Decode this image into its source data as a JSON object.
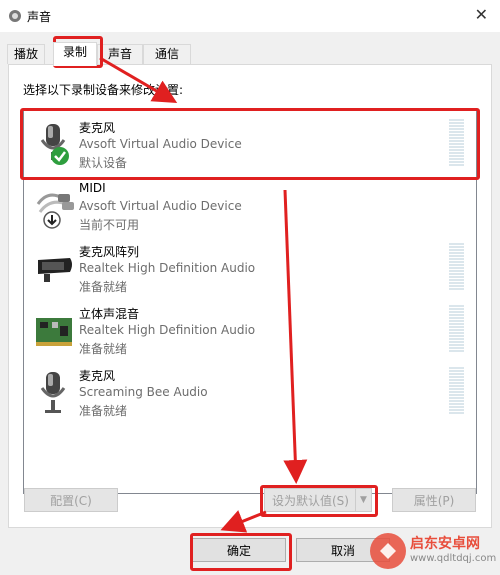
{
  "window": {
    "title": "声音",
    "close_glyph": "✕"
  },
  "tabs": [
    {
      "label": "播放",
      "active": false
    },
    {
      "label": "录制",
      "active": true
    },
    {
      "label": "声音",
      "active": false
    },
    {
      "label": "通信",
      "active": false
    }
  ],
  "instruction": "选择以下录制设备来修改设置:",
  "devices": [
    {
      "name": "麦克风",
      "description": "Avsoft Virtual Audio Device",
      "status": "默认设备",
      "icon": "microphone-icon",
      "badge": "default-check-icon",
      "selected": true
    },
    {
      "name": "MIDI",
      "description": "Avsoft Virtual Audio Device",
      "status": "当前不可用",
      "icon": "midi-cable-icon",
      "badge": "unavailable-arrow-icon",
      "selected": false
    },
    {
      "name": "麦克风阵列",
      "description": "Realtek High Definition Audio",
      "status": "准备就绪",
      "icon": "mic-array-icon",
      "selected": false
    },
    {
      "name": "立体声混音",
      "description": "Realtek High Definition Audio",
      "status": "准备就绪",
      "icon": "sound-card-icon",
      "selected": false
    },
    {
      "name": "麦克风",
      "description": "Screaming Bee Audio",
      "status": "准备就绪",
      "icon": "microphone-icon",
      "selected": false
    }
  ],
  "buttons": {
    "configure": "配置(C)",
    "set_default": "设为默认值(S)",
    "properties": "属性(P)",
    "ok": "确定",
    "cancel": "取消"
  },
  "watermark": {
    "text": "启东安卓网",
    "url": "www.qdltdqj.com"
  },
  "colors": {
    "annotation_red": "#e02020",
    "check_green": "#2e9e3e"
  }
}
